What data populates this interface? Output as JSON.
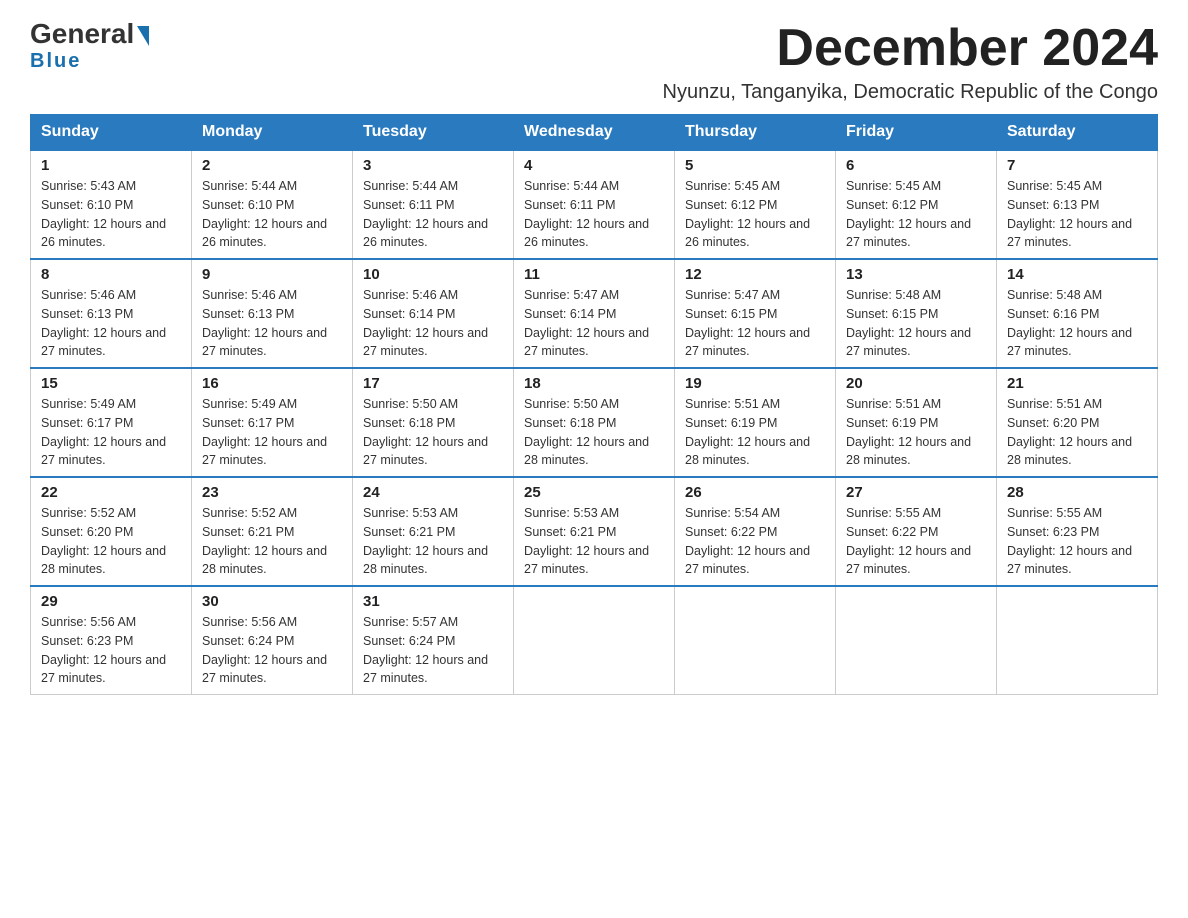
{
  "header": {
    "logo_general": "General",
    "logo_blue": "Blue",
    "month_title": "December 2024",
    "location": "Nyunzu, Tanganyika, Democratic Republic of the Congo"
  },
  "days_of_week": [
    "Sunday",
    "Monday",
    "Tuesday",
    "Wednesday",
    "Thursday",
    "Friday",
    "Saturday"
  ],
  "weeks": [
    [
      {
        "day": "1",
        "sunrise": "5:43 AM",
        "sunset": "6:10 PM",
        "daylight": "12 hours and 26 minutes."
      },
      {
        "day": "2",
        "sunrise": "5:44 AM",
        "sunset": "6:10 PM",
        "daylight": "12 hours and 26 minutes."
      },
      {
        "day": "3",
        "sunrise": "5:44 AM",
        "sunset": "6:11 PM",
        "daylight": "12 hours and 26 minutes."
      },
      {
        "day": "4",
        "sunrise": "5:44 AM",
        "sunset": "6:11 PM",
        "daylight": "12 hours and 26 minutes."
      },
      {
        "day": "5",
        "sunrise": "5:45 AM",
        "sunset": "6:12 PM",
        "daylight": "12 hours and 26 minutes."
      },
      {
        "day": "6",
        "sunrise": "5:45 AM",
        "sunset": "6:12 PM",
        "daylight": "12 hours and 27 minutes."
      },
      {
        "day": "7",
        "sunrise": "5:45 AM",
        "sunset": "6:13 PM",
        "daylight": "12 hours and 27 minutes."
      }
    ],
    [
      {
        "day": "8",
        "sunrise": "5:46 AM",
        "sunset": "6:13 PM",
        "daylight": "12 hours and 27 minutes."
      },
      {
        "day": "9",
        "sunrise": "5:46 AM",
        "sunset": "6:13 PM",
        "daylight": "12 hours and 27 minutes."
      },
      {
        "day": "10",
        "sunrise": "5:46 AM",
        "sunset": "6:14 PM",
        "daylight": "12 hours and 27 minutes."
      },
      {
        "day": "11",
        "sunrise": "5:47 AM",
        "sunset": "6:14 PM",
        "daylight": "12 hours and 27 minutes."
      },
      {
        "day": "12",
        "sunrise": "5:47 AM",
        "sunset": "6:15 PM",
        "daylight": "12 hours and 27 minutes."
      },
      {
        "day": "13",
        "sunrise": "5:48 AM",
        "sunset": "6:15 PM",
        "daylight": "12 hours and 27 minutes."
      },
      {
        "day": "14",
        "sunrise": "5:48 AM",
        "sunset": "6:16 PM",
        "daylight": "12 hours and 27 minutes."
      }
    ],
    [
      {
        "day": "15",
        "sunrise": "5:49 AM",
        "sunset": "6:17 PM",
        "daylight": "12 hours and 27 minutes."
      },
      {
        "day": "16",
        "sunrise": "5:49 AM",
        "sunset": "6:17 PM",
        "daylight": "12 hours and 27 minutes."
      },
      {
        "day": "17",
        "sunrise": "5:50 AM",
        "sunset": "6:18 PM",
        "daylight": "12 hours and 27 minutes."
      },
      {
        "day": "18",
        "sunrise": "5:50 AM",
        "sunset": "6:18 PM",
        "daylight": "12 hours and 28 minutes."
      },
      {
        "day": "19",
        "sunrise": "5:51 AM",
        "sunset": "6:19 PM",
        "daylight": "12 hours and 28 minutes."
      },
      {
        "day": "20",
        "sunrise": "5:51 AM",
        "sunset": "6:19 PM",
        "daylight": "12 hours and 28 minutes."
      },
      {
        "day": "21",
        "sunrise": "5:51 AM",
        "sunset": "6:20 PM",
        "daylight": "12 hours and 28 minutes."
      }
    ],
    [
      {
        "day": "22",
        "sunrise": "5:52 AM",
        "sunset": "6:20 PM",
        "daylight": "12 hours and 28 minutes."
      },
      {
        "day": "23",
        "sunrise": "5:52 AM",
        "sunset": "6:21 PM",
        "daylight": "12 hours and 28 minutes."
      },
      {
        "day": "24",
        "sunrise": "5:53 AM",
        "sunset": "6:21 PM",
        "daylight": "12 hours and 28 minutes."
      },
      {
        "day": "25",
        "sunrise": "5:53 AM",
        "sunset": "6:21 PM",
        "daylight": "12 hours and 27 minutes."
      },
      {
        "day": "26",
        "sunrise": "5:54 AM",
        "sunset": "6:22 PM",
        "daylight": "12 hours and 27 minutes."
      },
      {
        "day": "27",
        "sunrise": "5:55 AM",
        "sunset": "6:22 PM",
        "daylight": "12 hours and 27 minutes."
      },
      {
        "day": "28",
        "sunrise": "5:55 AM",
        "sunset": "6:23 PM",
        "daylight": "12 hours and 27 minutes."
      }
    ],
    [
      {
        "day": "29",
        "sunrise": "5:56 AM",
        "sunset": "6:23 PM",
        "daylight": "12 hours and 27 minutes."
      },
      {
        "day": "30",
        "sunrise": "5:56 AM",
        "sunset": "6:24 PM",
        "daylight": "12 hours and 27 minutes."
      },
      {
        "day": "31",
        "sunrise": "5:57 AM",
        "sunset": "6:24 PM",
        "daylight": "12 hours and 27 minutes."
      },
      null,
      null,
      null,
      null
    ]
  ]
}
